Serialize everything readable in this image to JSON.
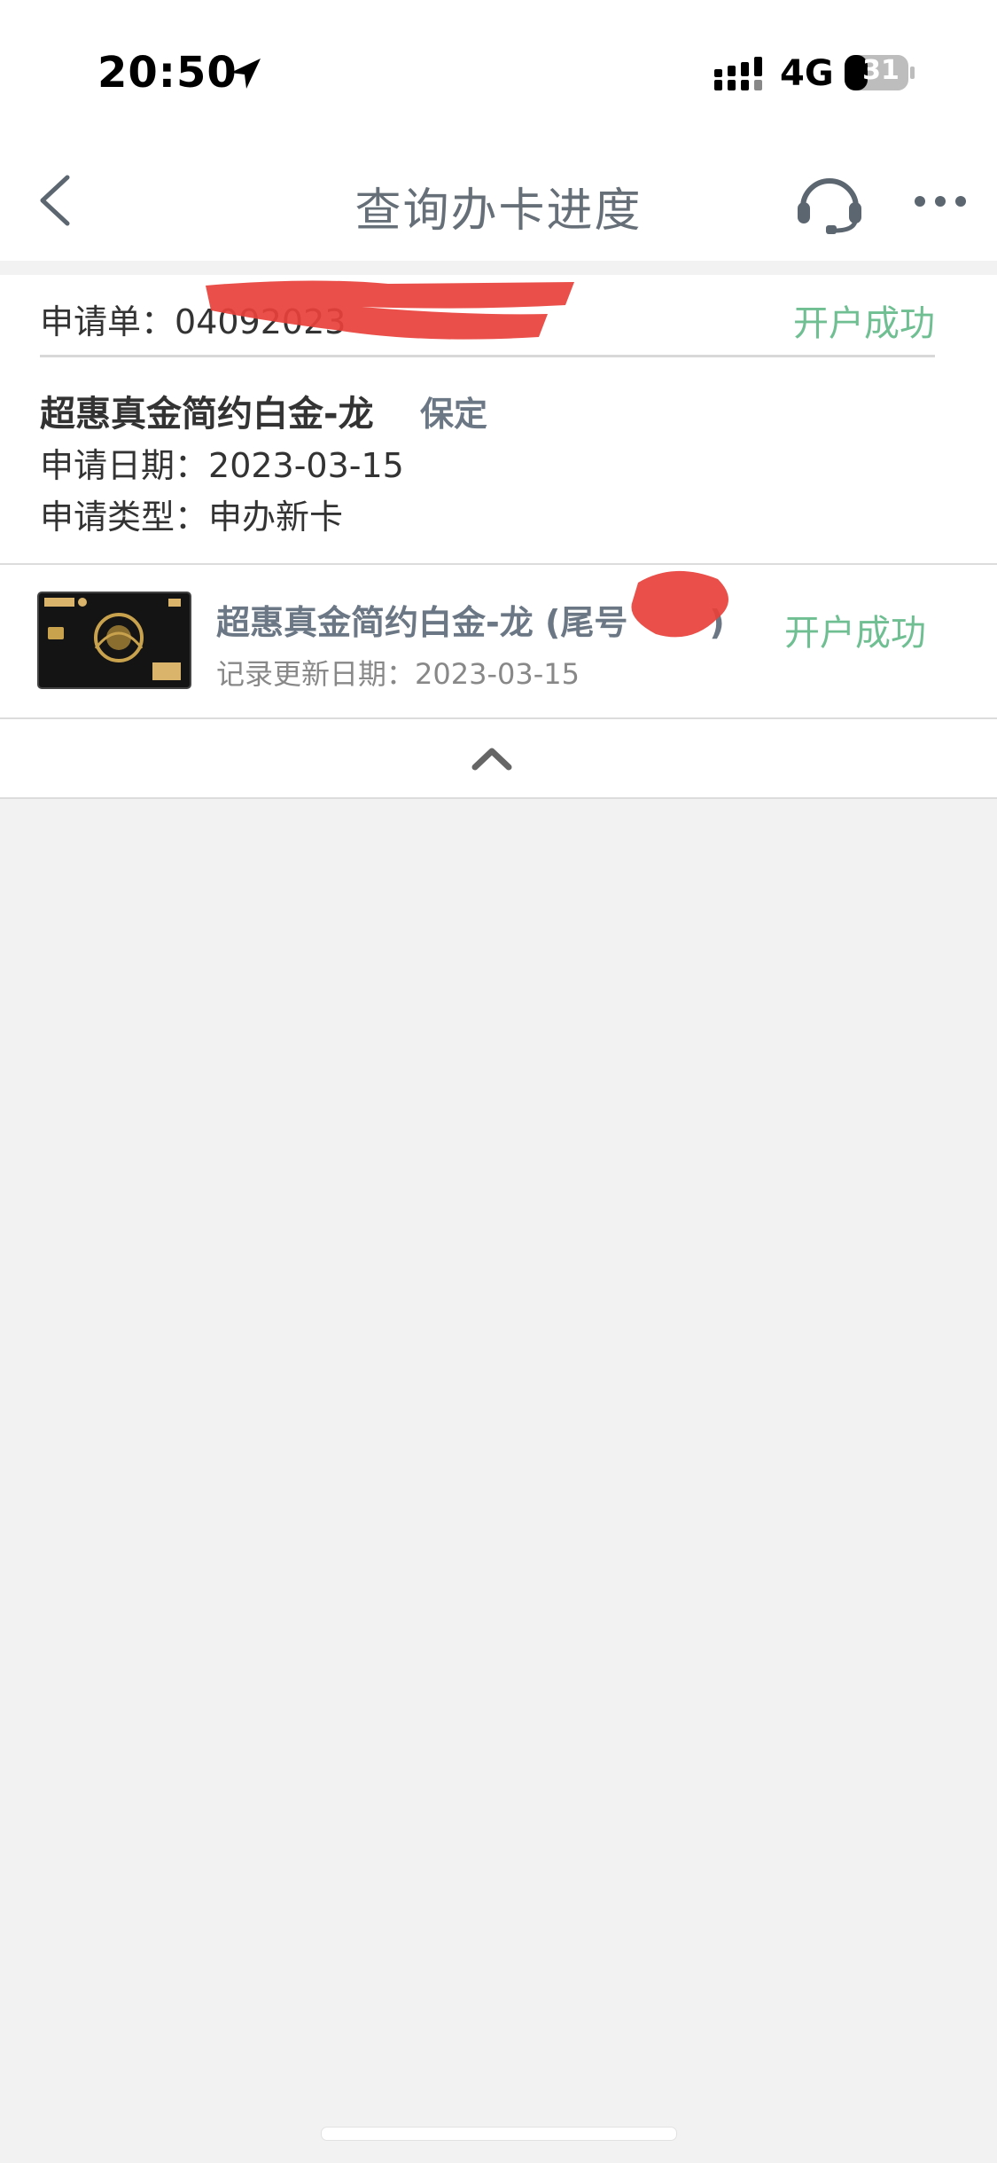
{
  "status_bar": {
    "time": "20:50",
    "network": "4G",
    "battery": "31"
  },
  "nav": {
    "title": "查询办卡进度",
    "icons": [
      "back-icon",
      "headset-icon",
      "more-icon"
    ]
  },
  "application": {
    "number_label": "申请单：",
    "number_value": "04092023",
    "status": "开户成功",
    "card_name": "超惠真金简约白金-龙",
    "tag": "保定",
    "date_label": "申请日期：",
    "date_value": "2023-03-15",
    "type_label": "申请类型：",
    "type_value": "申办新卡"
  },
  "record": {
    "card_name": "超惠真金简约白金-龙 (尾号",
    "card_name_suffix": ")",
    "update_label": "记录更新日期：",
    "update_value": "2023-03-15",
    "status": "开户成功"
  },
  "colors": {
    "success": "#6fbf93",
    "redaction": "#e8413a",
    "title": "#666f78"
  }
}
